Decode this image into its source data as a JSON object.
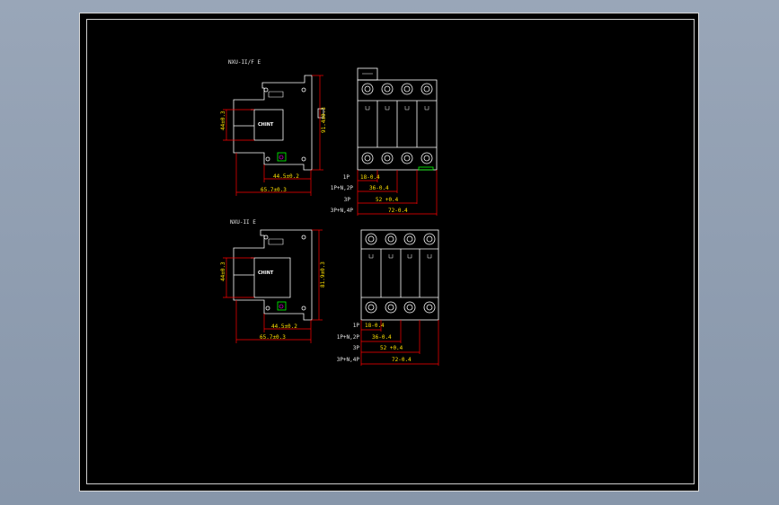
{
  "drawing": {
    "frame_color": "#d9d9d9",
    "background_color": "#000000",
    "line_color": "#ffffff",
    "dimension_color": "#ff0000",
    "text_color": "#ffe000",
    "top_model": {
      "model_label": "NXU-II/F E",
      "logo": "CHINT",
      "dim_height": "91.4±0.3",
      "dim_left": "44±0.3",
      "dim_width_inner": "44.5±0.2",
      "dim_width_outer": "65.7±0.3",
      "pole_rows": [
        {
          "label": "1P",
          "dim": "18-0.4"
        },
        {
          "label": "1P+N,2P",
          "dim": "36-0.4"
        },
        {
          "label": "3P",
          "dim": "52 +0.4"
        },
        {
          "label": "3P+N,4P",
          "dim": "72-0.4"
        }
      ]
    },
    "bottom_model": {
      "model_label": "NXU-II E",
      "logo": "CHINT",
      "dim_height": "81.9±0.3",
      "dim_left": "44±0.3",
      "dim_width_inner": "44.5±0.2",
      "dim_width_outer": "65.7±0.3",
      "pole_rows": [
        {
          "label": "1P",
          "dim": "18-0.4"
        },
        {
          "label": "1P+N,2P",
          "dim": "36-0.4"
        },
        {
          "label": "3P",
          "dim": "52 +0.4"
        },
        {
          "label": "3P+N,4P",
          "dim": "72-0.4"
        }
      ]
    }
  }
}
